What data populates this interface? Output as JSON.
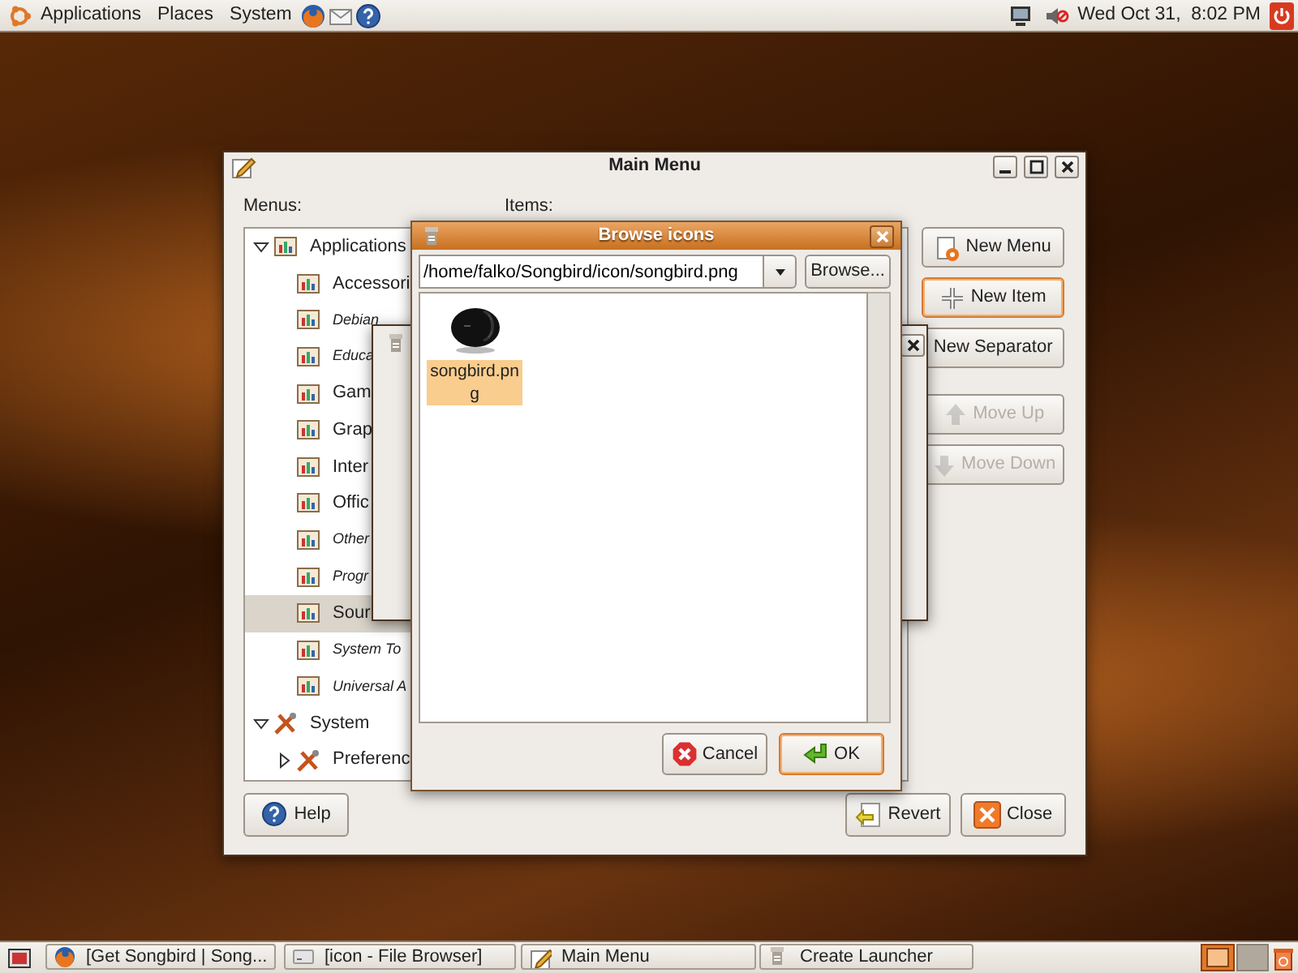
{
  "top_panel": {
    "menus": [
      "Applications",
      "Places",
      "System"
    ],
    "clock": "Wed Oct 31,  8:02 PM"
  },
  "main_window": {
    "title": "Main Menu",
    "menus_label": "Menus:",
    "items_label": "Items:",
    "tree": [
      {
        "label": "Applications",
        "expanded": true,
        "italic": false,
        "selected": false,
        "children": [
          {
            "label": "Accessori",
            "italic": false,
            "selected": false
          },
          {
            "label": "Debian",
            "italic": true,
            "selected": false
          },
          {
            "label": "Educa",
            "italic": true,
            "selected": false
          },
          {
            "label": "Gam",
            "italic": false,
            "selected": false
          },
          {
            "label": "Grap",
            "italic": false,
            "selected": false
          },
          {
            "label": "Inter",
            "italic": false,
            "selected": false
          },
          {
            "label": "Offic",
            "italic": false,
            "selected": false
          },
          {
            "label": "Other",
            "italic": true,
            "selected": false
          },
          {
            "label": "Progr",
            "italic": true,
            "selected": false
          },
          {
            "label": "Sour",
            "italic": false,
            "selected": true
          },
          {
            "label": "System To",
            "italic": true,
            "selected": false
          },
          {
            "label": "Universal A",
            "italic": true,
            "selected": false
          }
        ]
      },
      {
        "label": "System",
        "expanded": true,
        "italic": false,
        "selected": false,
        "children": [
          {
            "label": "Preferenc",
            "expanded": false,
            "italic": false,
            "selected": false
          }
        ]
      }
    ],
    "create_buttons": [
      {
        "label": "New Menu",
        "focused": false,
        "disabled": false
      },
      {
        "label": "New Item",
        "focused": true,
        "disabled": false
      },
      {
        "label": "New Separator",
        "focused": false,
        "disabled": false
      }
    ],
    "move_buttons": [
      {
        "label": "Move Up",
        "focused": false,
        "disabled": true
      },
      {
        "label": "Move Down",
        "focused": false,
        "disabled": true
      }
    ],
    "help_button": "Help",
    "revert_button": "Revert",
    "close_button": "Close"
  },
  "browse_dialog": {
    "title": "Browse icons",
    "path": "/home/falko/Songbird/icon/songbird.png",
    "browse_button": "Browse...",
    "icons": [
      {
        "label": "songbird.png",
        "selected": true
      }
    ],
    "buttons": [
      {
        "label": "Cancel",
        "focused": false
      },
      {
        "label": "OK",
        "focused": true
      }
    ]
  },
  "taskbar": [
    "[Get Songbird | Song...",
    "[icon - File Browser]",
    "Main Menu",
    "Create Launcher"
  ]
}
